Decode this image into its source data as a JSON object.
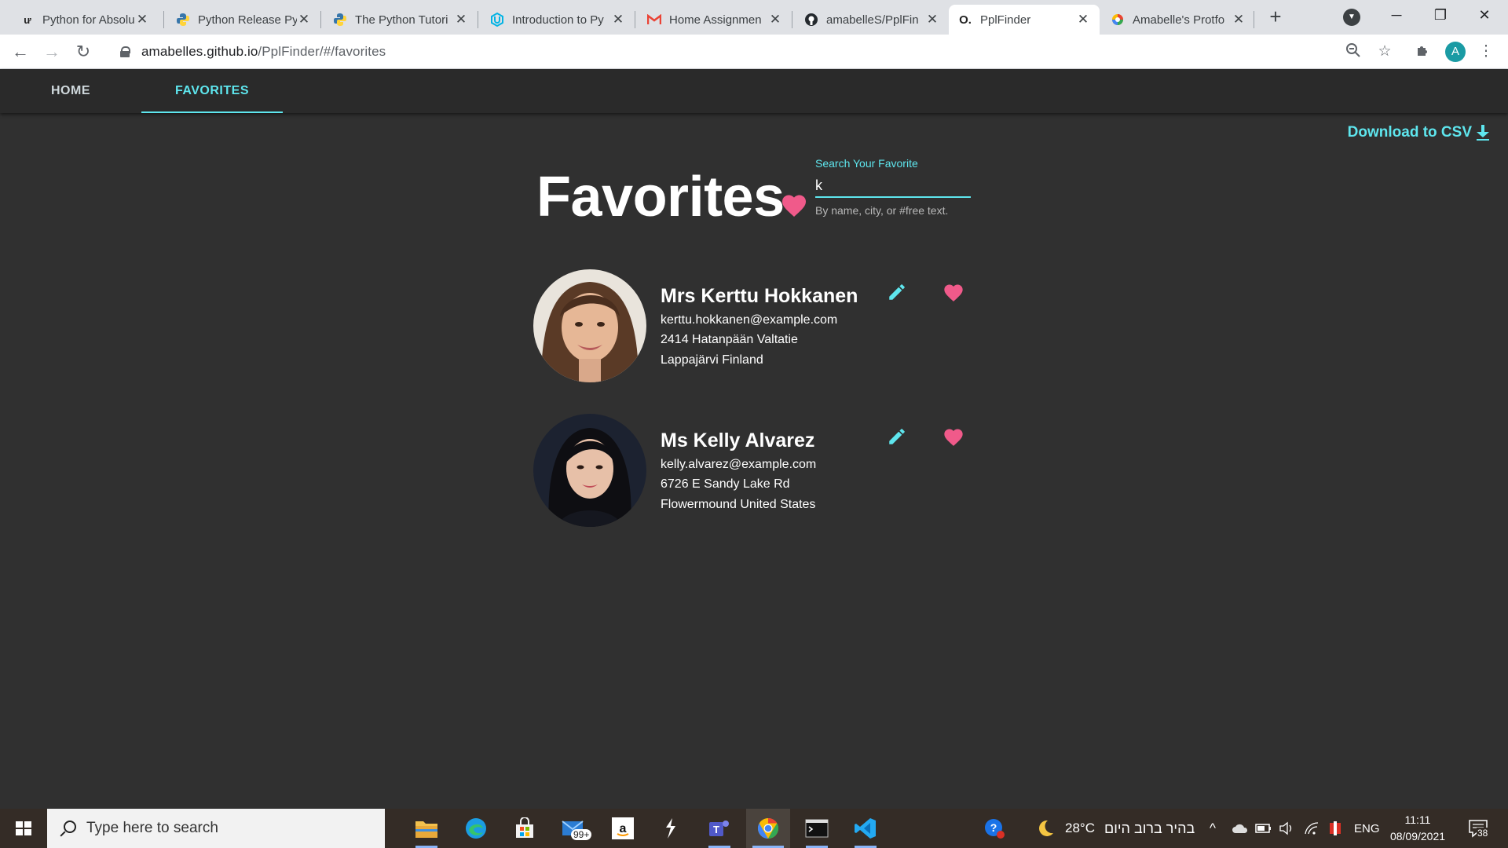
{
  "browser": {
    "tabs": [
      {
        "label": "Python for Absolu",
        "favicon": "u-logo-icon"
      },
      {
        "label": "Python Release Py",
        "favicon": "python-icon"
      },
      {
        "label": "The Python Tutori",
        "favicon": "python-icon"
      },
      {
        "label": "Introduction to Py",
        "favicon": "udacity-icon"
      },
      {
        "label": "Home Assignmen",
        "favicon": "gmail-icon"
      },
      {
        "label": "amabelleS/PplFin",
        "favicon": "github-icon"
      },
      {
        "label": "PplFinder",
        "favicon": "app-icon",
        "active": true
      },
      {
        "label": "Amabelle's Protfo",
        "favicon": "chrome-colorwheel-icon"
      }
    ],
    "url_host": "amabelles.github.io",
    "url_path": "/PplFinder/#/favorites",
    "profile_initial": "A"
  },
  "app": {
    "nav": {
      "home": "HOME",
      "favorites": "FAVORITES"
    },
    "csv_label": "Download to CSV",
    "title": "Favorites",
    "search": {
      "label": "Search Your Favorite",
      "value": "k",
      "hint": "By name, city, or #free text."
    },
    "people": [
      {
        "name": "Mrs Kerttu Hokkanen",
        "email": "kerttu.hokkanen@example.com",
        "street": "2414 Hatanpään Valtatie",
        "location": "Lappajärvi Finland"
      },
      {
        "name": "Ms Kelly Alvarez",
        "email": "kelly.alvarez@example.com",
        "street": "6726 E Sandy Lake Rd",
        "location": "Flowermound United States"
      }
    ],
    "colors": {
      "accent": "#5ee6ee",
      "heart": "#f05a8a",
      "background": "#303030"
    }
  },
  "taskbar": {
    "search_placeholder": "Type here to search",
    "mail_badge": "99+",
    "weather": "28°C",
    "weather_text": "בהיר ברוב היום",
    "language": "ENG",
    "time": "11:11",
    "date": "08/09/2021",
    "notifications": "38"
  }
}
